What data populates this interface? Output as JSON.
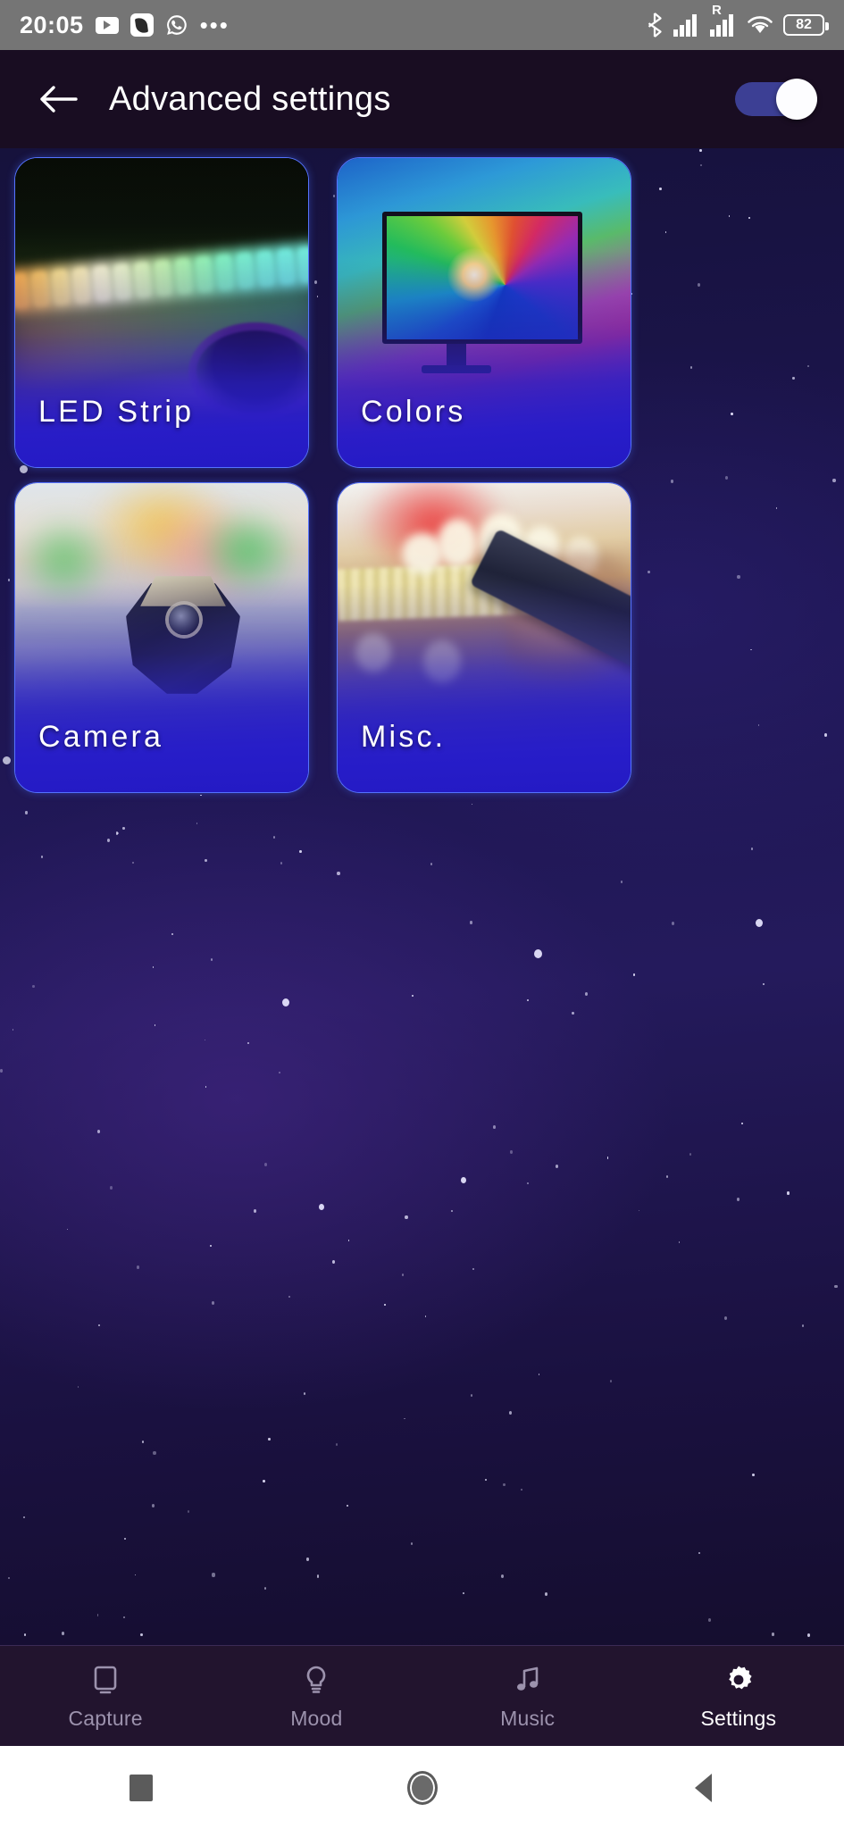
{
  "status_bar": {
    "time": "20:05",
    "left_icons": [
      "youtube-icon",
      "app-badge-icon",
      "whatsapp-icon",
      "overflow-dots-icon"
    ],
    "right_icons": [
      "bluetooth-icon",
      "cellular-signal-icon",
      "roaming-signal-icon",
      "wifi-icon",
      "battery-icon"
    ],
    "roaming_label": "R",
    "battery_level": "82",
    "background_color": "#757575"
  },
  "header": {
    "title": "Advanced settings",
    "back_icon": "arrow-left-icon",
    "toggle": {
      "state": "on",
      "track_color": "#3c3f94",
      "knob_color": "#fdfdff"
    },
    "background_color": "#190d22"
  },
  "cards": [
    {
      "id": "led-strip",
      "label": "LED Strip",
      "image": "led-strip-photo"
    },
    {
      "id": "colors",
      "label": "Colors",
      "image": "monitor-rainbow-photo"
    },
    {
      "id": "camera",
      "label": "Camera",
      "image": "camera-device-photo"
    },
    {
      "id": "misc",
      "label": "Misc.",
      "image": "phone-on-desk-photo"
    }
  ],
  "card_style": {
    "border_color": "#5573ff",
    "label_color": "#ffffff"
  },
  "bottom_nav": {
    "active": "Settings",
    "items": [
      {
        "label": "Capture",
        "icon": "monitor-icon"
      },
      {
        "label": "Mood",
        "icon": "lightbulb-icon"
      },
      {
        "label": "Music",
        "icon": "music-note-icon"
      },
      {
        "label": "Settings",
        "icon": "gear-icon"
      }
    ],
    "inactive_color": "#9c92ad",
    "active_color": "#ffffff",
    "background_color": "#22142e"
  },
  "android_nav": {
    "buttons": [
      {
        "name": "recents",
        "icon": "square-icon"
      },
      {
        "name": "home",
        "icon": "circle-icon"
      },
      {
        "name": "back",
        "icon": "triangle-left-icon"
      }
    ],
    "background_color": "#ffffff"
  }
}
